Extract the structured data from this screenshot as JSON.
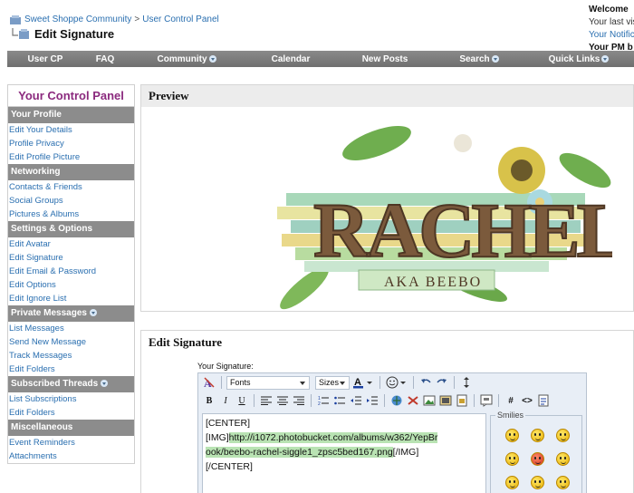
{
  "breadcrumb": {
    "community": "Sweet Shoppe Community",
    "separator": ">",
    "ucp": "User Control Panel"
  },
  "page_title": "Edit Signature",
  "welcome": {
    "title": "Welcome",
    "last_visit": "Your last visi",
    "notifications": "Your Notific",
    "pm": "Your PM b"
  },
  "navbar": {
    "items": [
      {
        "label": "User CP",
        "menu": false
      },
      {
        "label": "FAQ",
        "menu": false
      },
      {
        "label": "Community",
        "menu": true
      },
      {
        "label": "Calendar",
        "menu": false
      },
      {
        "label": "New Posts",
        "menu": false
      },
      {
        "label": "Search",
        "menu": true
      },
      {
        "label": "Quick Links",
        "menu": true
      }
    ]
  },
  "sidebar": {
    "title": "Your Control Panel",
    "sections": [
      {
        "heading": "Your Profile",
        "menu": false,
        "links": [
          "Edit Your Details",
          "Profile Privacy",
          "Edit Profile Picture"
        ]
      },
      {
        "heading": "Networking",
        "menu": false,
        "links": [
          "Contacts & Friends",
          "Social Groups",
          "Pictures & Albums"
        ]
      },
      {
        "heading": "Settings & Options",
        "menu": false,
        "links": [
          "Edit Avatar",
          "Edit Signature",
          "Edit Email & Password",
          "Edit Options",
          "Edit Ignore List"
        ]
      },
      {
        "heading": "Private Messages",
        "menu": true,
        "links": [
          "List Messages",
          "Send New Message",
          "Track Messages",
          "Edit Folders"
        ]
      },
      {
        "heading": "Subscribed Threads",
        "menu": true,
        "links": [
          "List Subscriptions",
          "Edit Folders"
        ]
      },
      {
        "heading": "Miscellaneous",
        "menu": false,
        "links": [
          "Event Reminders",
          "Attachments"
        ]
      }
    ]
  },
  "preview": {
    "heading": "Preview",
    "art_name": "RACHEL",
    "art_tagline": "AKA BEEBO"
  },
  "edit": {
    "heading": "Edit Signature",
    "your_signature_label": "Your Signature:",
    "fonts_label": "Fonts",
    "sizes_label": "Sizes",
    "lines": [
      {
        "pre": "[CENTER]",
        "hl": "",
        "post": ""
      },
      {
        "pre": "[IMG]",
        "hl": "http://i1072.photobucket.com/albums/w362/YepBr",
        "post": ""
      },
      {
        "pre": "",
        "hl": "ook/beebo-rachel-siggle1_zpsc5bed167.png",
        "post": "[/IMG]"
      },
      {
        "pre": "[/CENTER]",
        "hl": "",
        "post": ""
      }
    ],
    "smilies_label": "Smilies"
  },
  "colors": {
    "link": "#2a6fb0",
    "nav_bg": "#7d7d7d",
    "sidebar_title": "#8b2a7e",
    "highlight": "#b9e3b3"
  }
}
